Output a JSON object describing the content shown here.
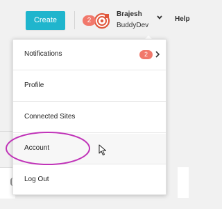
{
  "header": {
    "create_label": "Create",
    "notification_count": "2",
    "user_name": "Brajesh",
    "user_site": "BuddyDev",
    "help_label": "Help",
    "avatar_icon": "pinwheel-avatar-icon",
    "caret_icon": "chevron-down-icon"
  },
  "menu": {
    "items": [
      {
        "label": "Notifications",
        "badge": "2",
        "has_chevron": true
      },
      {
        "label": "Profile"
      },
      {
        "label": "Connected Sites"
      },
      {
        "label": "Account",
        "highlighted": true
      },
      {
        "label": "Log Out"
      }
    ]
  },
  "colors": {
    "accent": "#1fb5cd",
    "badge": "#f1786b",
    "annotation": "#c033b8"
  }
}
